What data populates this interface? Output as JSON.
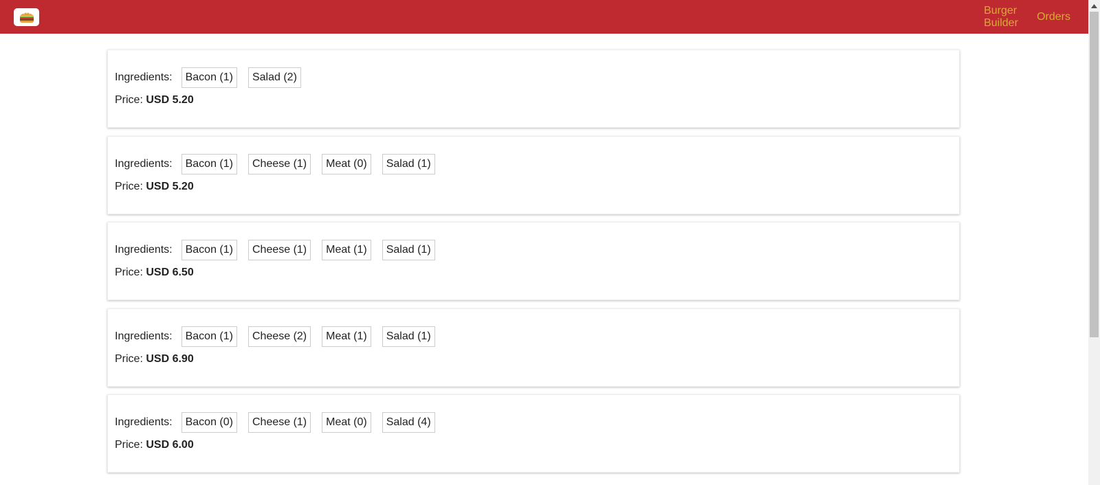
{
  "header": {
    "logo_icon": "burger-icon",
    "nav": [
      {
        "label": "Burger Builder"
      },
      {
        "label": "Orders"
      }
    ],
    "colors": {
      "toolbar": "#bf2a31",
      "nav_text": "#d9a935"
    }
  },
  "orders": [
    {
      "ingredients_label": "Ingredients:",
      "ingredients": [
        "Bacon (1)",
        "Salad (2)"
      ],
      "price_label": "Price:",
      "price": "USD 5.20"
    },
    {
      "ingredients_label": "Ingredients:",
      "ingredients": [
        "Bacon (1)",
        "Cheese (1)",
        "Meat (0)",
        "Salad (1)"
      ],
      "price_label": "Price:",
      "price": "USD 5.20"
    },
    {
      "ingredients_label": "Ingredients:",
      "ingredients": [
        "Bacon (1)",
        "Cheese (1)",
        "Meat (1)",
        "Salad (1)"
      ],
      "price_label": "Price:",
      "price": "USD 6.50"
    },
    {
      "ingredients_label": "Ingredients:",
      "ingredients": [
        "Bacon (1)",
        "Cheese (2)",
        "Meat (1)",
        "Salad (1)"
      ],
      "price_label": "Price:",
      "price": "USD 6.90"
    },
    {
      "ingredients_label": "Ingredients:",
      "ingredients": [
        "Bacon (0)",
        "Cheese (1)",
        "Meat (0)",
        "Salad (4)"
      ],
      "price_label": "Price:",
      "price": "USD 6.00"
    }
  ]
}
